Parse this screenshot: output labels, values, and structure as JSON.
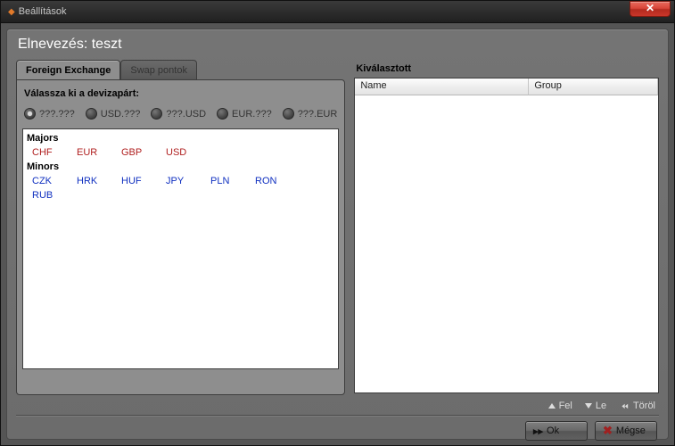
{
  "window": {
    "title": "Beállítások"
  },
  "header": {
    "name_prefix": "Elnevezés:",
    "name_value": "teszt"
  },
  "tabs": [
    {
      "label": "Foreign Exchange",
      "active": true
    },
    {
      "label": "Swap pontok",
      "active": false
    }
  ],
  "filter": {
    "label": "Válassza ki a devizapárt:",
    "options": [
      {
        "label": "???.???",
        "selected": true
      },
      {
        "label": "USD.???",
        "selected": false
      },
      {
        "label": "???.USD",
        "selected": false
      },
      {
        "label": "EUR.???",
        "selected": false
      },
      {
        "label": "???.EUR",
        "selected": false
      }
    ]
  },
  "currencies": {
    "majors_title": "Majors",
    "minors_title": "Minors",
    "majors": [
      "CHF",
      "EUR",
      "GBP",
      "USD"
    ],
    "minors": [
      "CZK",
      "HRK",
      "HUF",
      "JPY",
      "PLN",
      "RON",
      "RUB"
    ]
  },
  "selected_panel": {
    "title": "Kiválasztott",
    "columns": {
      "name": "Name",
      "group": "Group"
    },
    "rows": []
  },
  "list_actions": {
    "up": "Fel",
    "down": "Le",
    "clear": "Töröl"
  },
  "dialog_buttons": {
    "ok": "Ok",
    "cancel": "Mégse"
  }
}
